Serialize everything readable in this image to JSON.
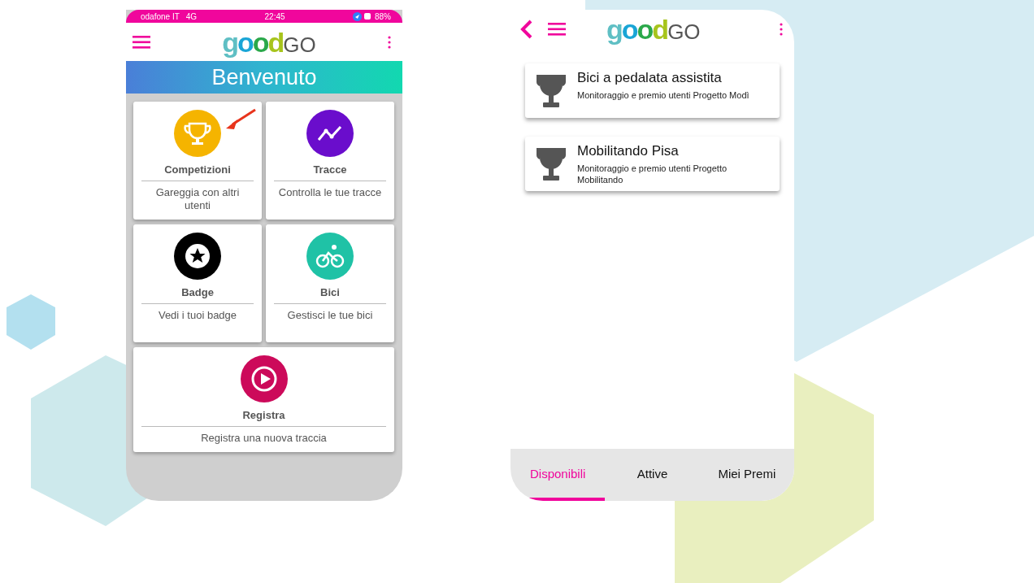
{
  "home_screen": {
    "status_bar": {
      "carrier": "odafone IT",
      "network": "4G",
      "time": "22:45",
      "battery": "88%"
    },
    "logo": {
      "part_1": "good",
      "part_2": "GO"
    },
    "banner": "Benvenuto",
    "tiles": [
      {
        "title": "Competizioni",
        "subtitle": "Gareggia con altri utenti",
        "color": "#f5b400",
        "wide": false,
        "highlighted": true
      },
      {
        "title": "Tracce",
        "subtitle": "Controlla le tue tracce",
        "color": "#6a0dcc",
        "wide": false,
        "highlighted": false
      },
      {
        "title": "Badge",
        "subtitle": "Vedi i tuoi badge",
        "color": "#000000",
        "wide": false,
        "highlighted": false
      },
      {
        "title": "Bici",
        "subtitle": "Gestisci le tue bici",
        "color": "#1fc2a6",
        "wide": false,
        "highlighted": false
      },
      {
        "title": "Registra",
        "subtitle": "Registra una nuova traccia",
        "color": "#cc0a5a",
        "wide": true,
        "highlighted": false
      }
    ]
  },
  "competitions_screen": {
    "logo": {
      "part_1": "good",
      "part_2": "GO"
    },
    "competitions": [
      {
        "title": "Bici a pedalata assistita",
        "description": "Monitoraggio e premio utenti Progetto Modì"
      },
      {
        "title": "Mobilitando Pisa",
        "description": "Monitoraggio e premio utenti Progetto Mobilitando"
      }
    ],
    "tabs": [
      {
        "label": "Disponibili",
        "selected": true
      },
      {
        "label": "Attive",
        "selected": false
      },
      {
        "label": "Miei Premi",
        "selected": false
      }
    ]
  }
}
